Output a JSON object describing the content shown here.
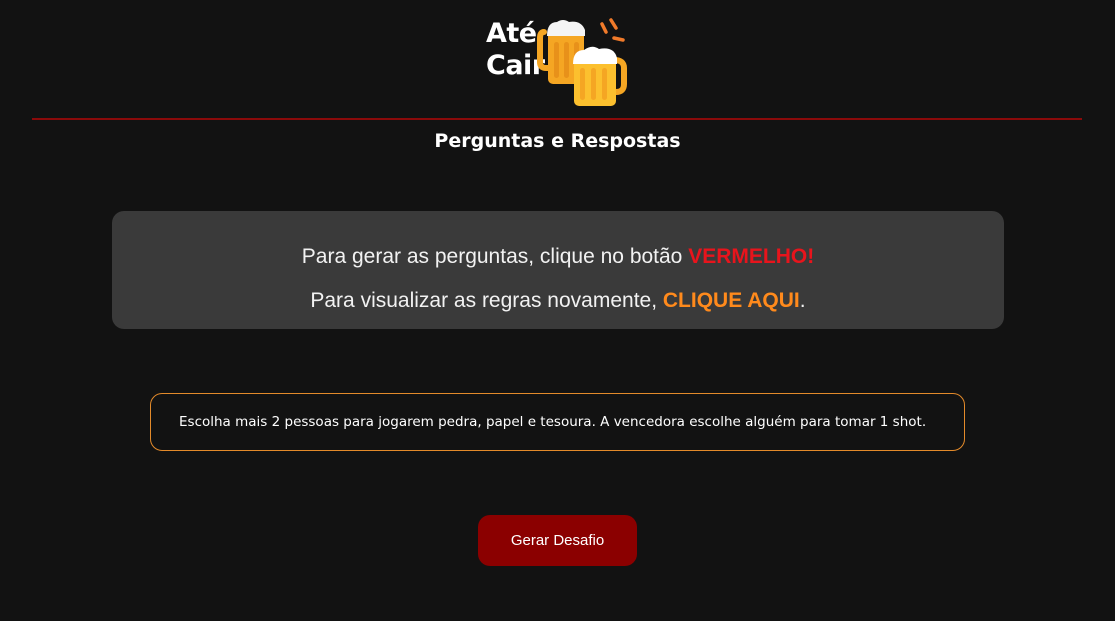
{
  "header": {
    "logo_line1": "Até",
    "logo_line2": "Cair",
    "logo_icon": "beer-mugs-cheers-icon",
    "subtitle": "Perguntas e Respostas"
  },
  "info": {
    "line1_prefix": "Para gerar as perguntas, clique no botão ",
    "line1_highlight": "VERMELHO!",
    "line2_prefix": "Para visualizar as regras novamente, ",
    "line2_link": "CLIQUE AQUI",
    "line2_suffix": "."
  },
  "challenge": {
    "text": "Escolha mais 2 pessoas para jogarem pedra, papel e tesoura. A vencedora escolhe alguém para tomar 1 shot."
  },
  "actions": {
    "generate_label": "Gerar Desafio"
  },
  "colors": {
    "background": "#121212",
    "divider": "#8b0a0a",
    "info_box": "#3a3a3a",
    "highlight_red": "#e8141c",
    "highlight_orange": "#ff8a1c",
    "challenge_border": "#e38a2a",
    "button": "#8b0000"
  }
}
